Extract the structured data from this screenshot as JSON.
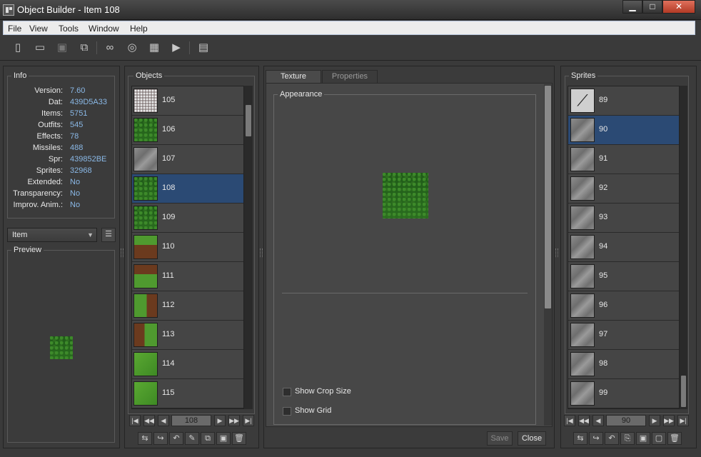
{
  "window": {
    "title": "Object Builder - Item 108",
    "min_label": "▁",
    "max_label": "□",
    "close_label": "✕"
  },
  "menu": [
    "File",
    "View",
    "Tools",
    "Window",
    "Help"
  ],
  "toolbar_icons": [
    "new-file",
    "open-folder",
    "save",
    "save-as",
    "binoculars",
    "find-sprites",
    "grid",
    "animation-player",
    "settings"
  ],
  "info": {
    "title": "Info",
    "rows": [
      {
        "label": "Version:",
        "value": "7.60"
      },
      {
        "label": "Dat:",
        "value": "439D5A33"
      },
      {
        "label": "Items:",
        "value": "5751"
      },
      {
        "label": "Outfits:",
        "value": "545"
      },
      {
        "label": "Effects:",
        "value": "78"
      },
      {
        "label": "Missiles:",
        "value": "488"
      },
      {
        "label": "Spr:",
        "value": "439852BE"
      },
      {
        "label": "Sprites:",
        "value": "32968"
      },
      {
        "label": "Extended:",
        "value": "No"
      },
      {
        "label": "Transparency:",
        "value": "No"
      },
      {
        "label": "Improv. Anim.:",
        "value": "No"
      }
    ]
  },
  "category_select": {
    "value": "Item"
  },
  "preview": {
    "title": "Preview"
  },
  "objects": {
    "title": "Objects",
    "items": [
      {
        "id": "105",
        "tex": "gravel"
      },
      {
        "id": "106",
        "tex": "grass"
      },
      {
        "id": "107",
        "tex": "stone"
      },
      {
        "id": "108",
        "tex": "grass"
      },
      {
        "id": "109",
        "tex": "grass"
      },
      {
        "id": "110",
        "tex": "grassdirt"
      },
      {
        "id": "111",
        "tex": "dirtgrass"
      },
      {
        "id": "112",
        "tex": "grassdirt-v"
      },
      {
        "id": "113",
        "tex": "dirtgrass-v"
      },
      {
        "id": "114",
        "tex": "grassfull"
      },
      {
        "id": "115",
        "tex": "grassfull"
      }
    ],
    "selected": "108",
    "page_value": "108"
  },
  "editor": {
    "tabs": [
      "Texture",
      "Properties"
    ],
    "active_tab": "Texture",
    "appearance_title": "Appearance",
    "show_crop_size": "Show Crop Size",
    "show_grid": "Show Grid",
    "save_label": "Save",
    "close_label": "Close"
  },
  "sprites": {
    "title": "Sprites",
    "items": [
      {
        "id": "89",
        "tex": "fishbone"
      },
      {
        "id": "90",
        "tex": "stone"
      },
      {
        "id": "91",
        "tex": "stone"
      },
      {
        "id": "92",
        "tex": "stone"
      },
      {
        "id": "93",
        "tex": "stone"
      },
      {
        "id": "94",
        "tex": "stone"
      },
      {
        "id": "95",
        "tex": "stone"
      },
      {
        "id": "96",
        "tex": "stone"
      },
      {
        "id": "97",
        "tex": "stone"
      },
      {
        "id": "98",
        "tex": "stone"
      },
      {
        "id": "99",
        "tex": "stone"
      }
    ],
    "selected": "90",
    "page_value": "90"
  },
  "nav_glyphs": {
    "first": "|◀",
    "prev_fast": "◀◀",
    "prev": "◀",
    "next": "▶",
    "next_fast": "▶▶",
    "last": "▶|"
  }
}
